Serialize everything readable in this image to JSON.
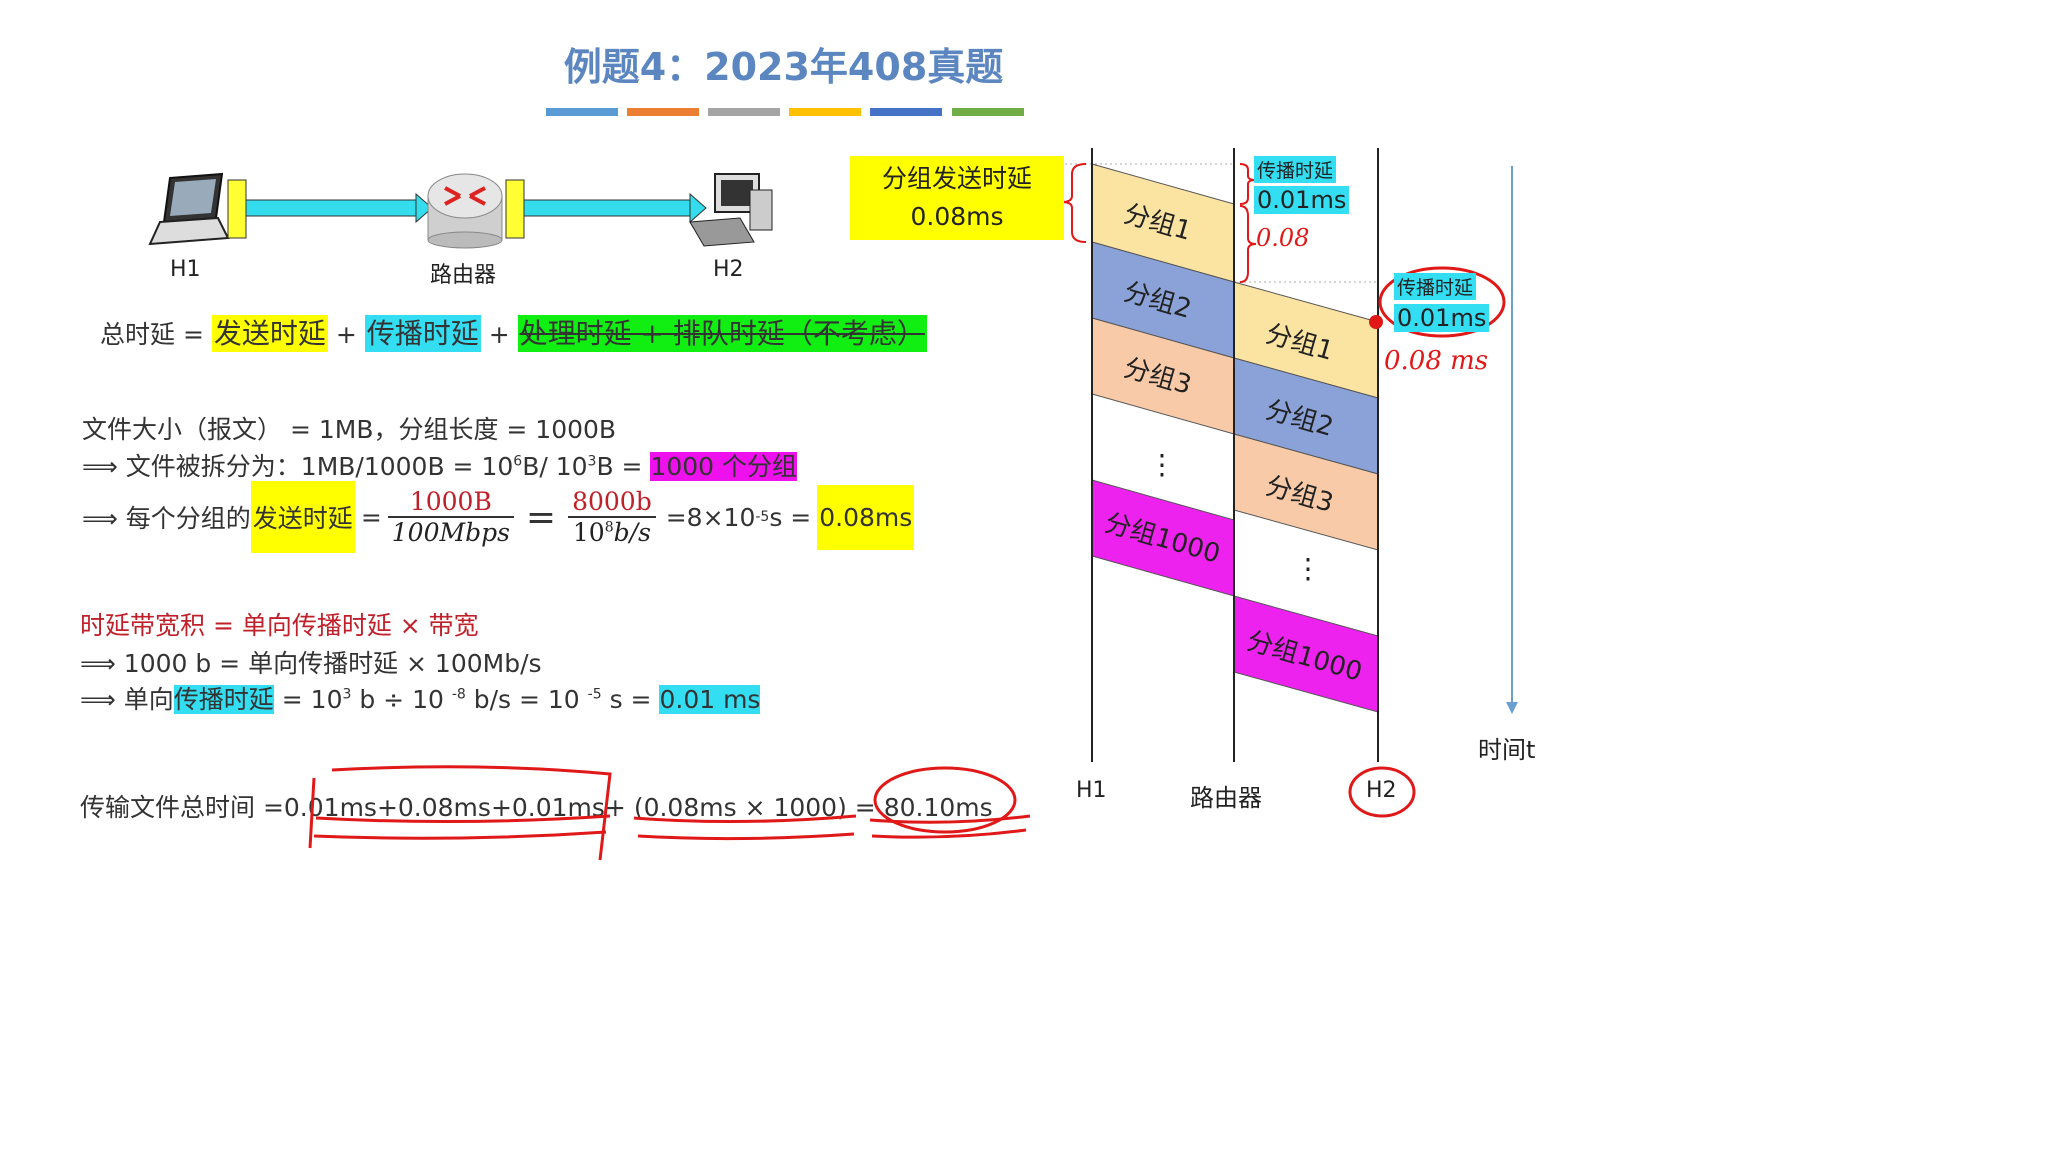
{
  "title": "例题4：2023年408真题",
  "color_bars": [
    "#5b9bd5",
    "#ed7d31",
    "#a5a5a5",
    "#ffc000",
    "#4472c4",
    "#70ad47"
  ],
  "network": {
    "h1_label": "H1",
    "router_label": "路由器",
    "h2_label": "H2"
  },
  "delay_formula": {
    "prefix": "总时延 =",
    "send": "发送时延",
    "plus1": "+",
    "prop": "传播时延",
    "plus2": "+",
    "proc_queue": "处理时延 + 排队时延（不考虑）"
  },
  "file_calc": {
    "line1": "文件大小（报文） = 1MB，分组长度 = 1000B",
    "line2_prefix": "⟹ 文件被拆分为：1MB/1000B = 10",
    "line2_exp1": "6",
    "line2_mid": "B/ 10",
    "line2_exp2": "3",
    "line2_suffix": "B =",
    "line2_highlight": "1000 个分组",
    "line3_prefix": "⟹ 每个分组的",
    "line3_highlight": "发送时延",
    "line3_eq": "=",
    "frac1_num": "1000B",
    "frac1_den": "100Mbps",
    "eq2": "=",
    "frac2_num": "8000b",
    "frac2_den_base": "10",
    "frac2_den_exp": "8",
    "frac2_den_unit": "b/s",
    "line3_result_prefix": "=8×10",
    "line3_result_exp": "-5",
    "line3_result_suffix": " s =",
    "line3_result": "0.08ms"
  },
  "bdp": {
    "line1": "时延带宽积 = 单向传播时延 × 带宽",
    "line2": "⟹ 1000 b = 单向传播时延 × 100Mb/s",
    "line3_prefix": "⟹ 单向",
    "line3_highlight": "传播时延",
    "line3_a": "= 10",
    "line3_exp1": "3",
    "line3_b": " b  ÷  10 ",
    "line3_exp2": "-8",
    "line3_c": " b/s = 10 ",
    "line3_exp3": "-5",
    "line3_d": " s =",
    "line3_result": "0.01 ms"
  },
  "total": {
    "prefix": "传输文件总时间 =",
    "expr": "0.01ms+0.08ms+0.01ms+ (0.08ms × 1000) =",
    "result": "80.10ms"
  },
  "timeline": {
    "send_delay_label_1": "分组发送时延",
    "send_delay_label_2": "0.08ms",
    "prop_label_1_title": "传播时延",
    "prop_label_1_value": "0.01ms",
    "prop_label_2_title": "传播时延",
    "prop_label_2_value": "0.01ms",
    "hand_note_1": "0.08",
    "hand_note_2": "0.08 ms",
    "h1_packets": [
      "分组1",
      "分组2",
      "分组3",
      "⋮",
      "分组1000"
    ],
    "router_packets": [
      "分组1",
      "分组2",
      "分组3",
      "⋮",
      "分组1000"
    ],
    "axis_h1": "H1",
    "axis_router": "路由器",
    "axis_h2": "H2",
    "time_label": "时间t"
  }
}
